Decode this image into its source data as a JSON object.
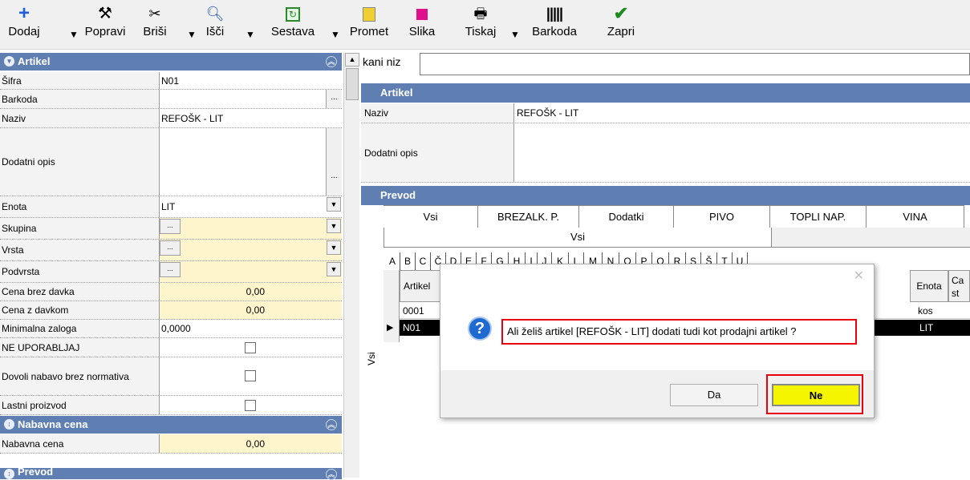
{
  "toolbar": {
    "add": "Dodaj",
    "edit": "Popravi",
    "delete": "Briši",
    "search": "Išči",
    "composition": "Sestava",
    "traffic": "Promet",
    "image": "Slika",
    "print": "Tiskaj",
    "barcode": "Barkoda",
    "close": "Zapri"
  },
  "left": {
    "section_artikel": "Artikel",
    "sifra_label": "Šifra",
    "sifra_value": "N01",
    "barkoda_label": "Barkoda",
    "barkoda_value": "",
    "naziv_label": "Naziv",
    "naziv_value": "REFOŠK - LIT",
    "opis_label": "Dodatni opis",
    "opis_value": "",
    "enota_label": "Enota",
    "enota_value": "LIT",
    "skupina_label": "Skupina",
    "vrsta_label": "Vrsta",
    "podvrsta_label": "Podvrsta",
    "ellipsis": "...",
    "cena_brez_label": "Cena brez davka",
    "cena_brez_value": "0,00",
    "cena_z_label": "Cena z davkom",
    "cena_z_value": "0,00",
    "min_zaloga_label": "Minimalna zaloga",
    "min_zaloga_value": "0,0000",
    "ne_uporabljaj_label": "NE UPORABLJAJ",
    "dovoli_label": "Dovoli nabavo brez normativa",
    "lastni_label": "Lastni proizvod",
    "section_nabavna": "Nabavna cena",
    "nabavna_label": "Nabavna cena",
    "nabavna_value": "0,00",
    "section_prevod": "Prevod"
  },
  "right": {
    "search_label": "kani niz",
    "search_value": "",
    "section_artikel": "Artikel",
    "naziv_label": "Naziv",
    "naziv_value": "REFOŠK - LIT",
    "opis_label": "Dodatni opis",
    "section_prevod": "Prevod",
    "tabs": [
      "Vsi",
      "BREZALK. P.",
      "Dodatki",
      "PIVO",
      "TOPLI NAP.",
      "VINA"
    ],
    "subtab": "Vsi",
    "letters": [
      "A",
      "B",
      "C",
      "Č",
      "D",
      "E",
      "F",
      "G",
      "H",
      "I",
      "J",
      "K",
      "L",
      "M",
      "N",
      "O",
      "P",
      "Q",
      "R",
      "S",
      "Š",
      "T",
      "U"
    ],
    "side_label": "Vsi",
    "grid_col_artikel": "Artikel",
    "grid_col_enota": "Enota",
    "grid_col_cena": "Ca st",
    "grid_rows": [
      {
        "artikel": "0001",
        "enota": "kos"
      },
      {
        "artikel": "N01",
        "enota": "LIT"
      }
    ]
  },
  "dialog": {
    "message": "Ali želiš artikel [REFOŠK - LIT] dodati tudi kot prodajni artikel ?",
    "yes": "Da",
    "no": "Ne"
  },
  "colors": {
    "section_header": "#5f7fb3",
    "highlight_yellow": "#fff5cc",
    "focused_button": "#f5f500",
    "annotation_red": "#e8000f",
    "selected_row": "#000000"
  },
  "icons": [
    "plus-icon",
    "hammer-icon",
    "scissors-icon",
    "magnifier-icon",
    "composition-icon",
    "traffic-icon",
    "image-icon",
    "printer-icon",
    "barcode-icon",
    "checkmark-icon",
    "question-icon"
  ]
}
